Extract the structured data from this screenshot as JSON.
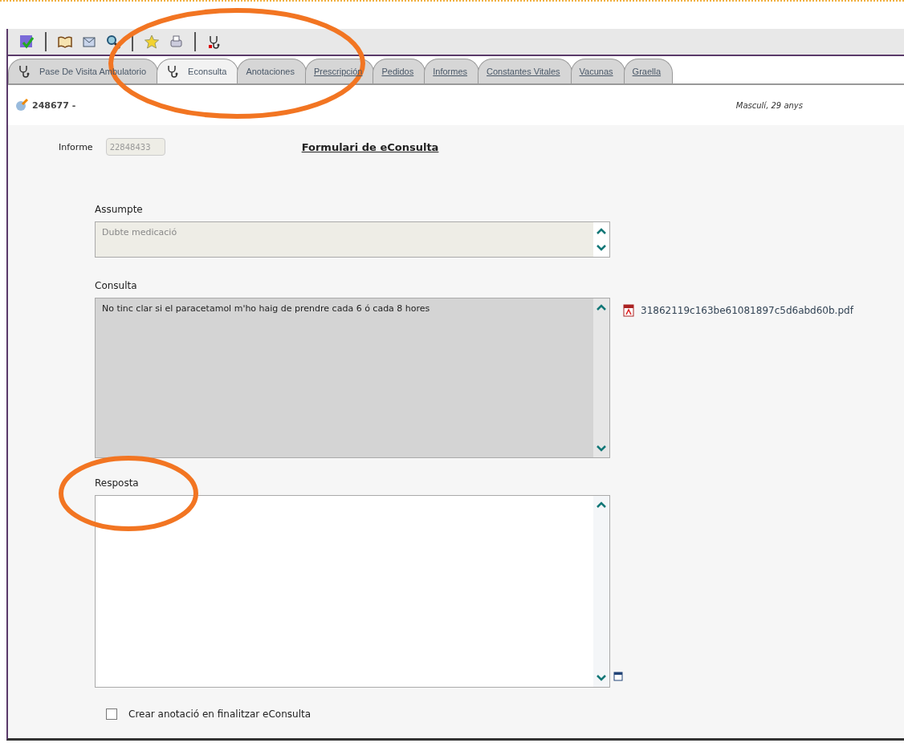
{
  "toolbar": [
    {
      "kind": "save"
    },
    {
      "kind": "separator"
    },
    {
      "kind": "book"
    },
    {
      "kind": "mail"
    },
    {
      "kind": "search"
    },
    {
      "kind": "separator"
    },
    {
      "kind": "star"
    },
    {
      "kind": "print"
    },
    {
      "kind": "separator"
    },
    {
      "kind": "stethoscope"
    }
  ],
  "tabs": [
    {
      "label": "Pase De Visita Ambulatorio",
      "icon": true,
      "underlined": false,
      "selected": false
    },
    {
      "label": "Econsulta",
      "icon": true,
      "underlined": false,
      "selected": true
    },
    {
      "label": "Anotaciones",
      "icon": false,
      "underlined": false,
      "selected": false
    },
    {
      "label": "Prescripción",
      "icon": false,
      "underlined": true,
      "selected": false
    },
    {
      "label": "Pedidos",
      "icon": false,
      "underlined": true,
      "selected": false
    },
    {
      "label": "Informes",
      "icon": false,
      "underlined": true,
      "selected": false
    },
    {
      "label": "Constantes Vitales",
      "icon": false,
      "underlined": true,
      "selected": false
    },
    {
      "label": "Vacunas",
      "icon": false,
      "underlined": true,
      "selected": false
    },
    {
      "label": "Graella",
      "icon": false,
      "underlined": true,
      "selected": false
    }
  ],
  "patient": {
    "id": "248677 -",
    "info": "Masculí, 29 anys"
  },
  "form": {
    "report_label": "Informe",
    "report_value": "22848433",
    "title": "Formulari de eConsulta",
    "subject": {
      "label": "Assumpte",
      "value": "Dubte medicació"
    },
    "query": {
      "label": "Consulta",
      "value": "No tinc clar si el paracetamol m'ho haig de prendre cada 6 ó cada 8 hores",
      "attachment": "31862119c163be61081897c5d6abd60b.pdf"
    },
    "answer": {
      "label": "Resposta"
    },
    "create_note": {
      "label": "Crear anotació en finalitzar eConsulta",
      "checked": false
    }
  },
  "annotations": [
    {
      "kind": "ellipse"
    },
    {
      "kind": "ellipse"
    }
  ]
}
